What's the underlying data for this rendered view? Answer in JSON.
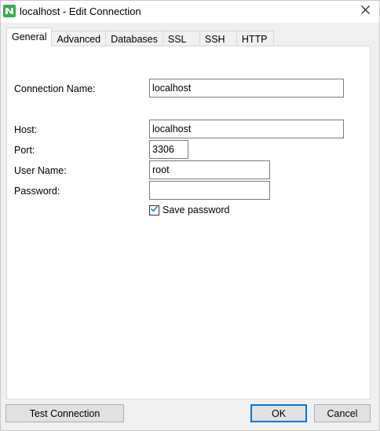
{
  "window": {
    "title": "localhost - Edit Connection"
  },
  "tabs": [
    {
      "label": "General",
      "active": true
    },
    {
      "label": "Advanced",
      "active": false
    },
    {
      "label": "Databases",
      "active": false
    },
    {
      "label": "SSL",
      "active": false
    },
    {
      "label": "SSH",
      "active": false
    },
    {
      "label": "HTTP",
      "active": false
    }
  ],
  "form": {
    "connection_name": {
      "label": "Connection Name:",
      "value": "localhost"
    },
    "host": {
      "label": "Host:",
      "value": "localhost"
    },
    "port": {
      "label": "Port:",
      "value": "3306"
    },
    "user_name": {
      "label": "User Name:",
      "value": "root"
    },
    "password": {
      "label": "Password:",
      "value": ""
    },
    "save_password": {
      "label": "Save password",
      "checked": true
    }
  },
  "buttons": {
    "test_connection": "Test Connection",
    "ok": "OK",
    "cancel": "Cancel"
  },
  "colors": {
    "app_icon": "#2fb34a",
    "accent": "#0078d7"
  },
  "icons": {
    "app": "navicat-app-icon",
    "close": "close-icon",
    "check": "checkmark-icon"
  }
}
